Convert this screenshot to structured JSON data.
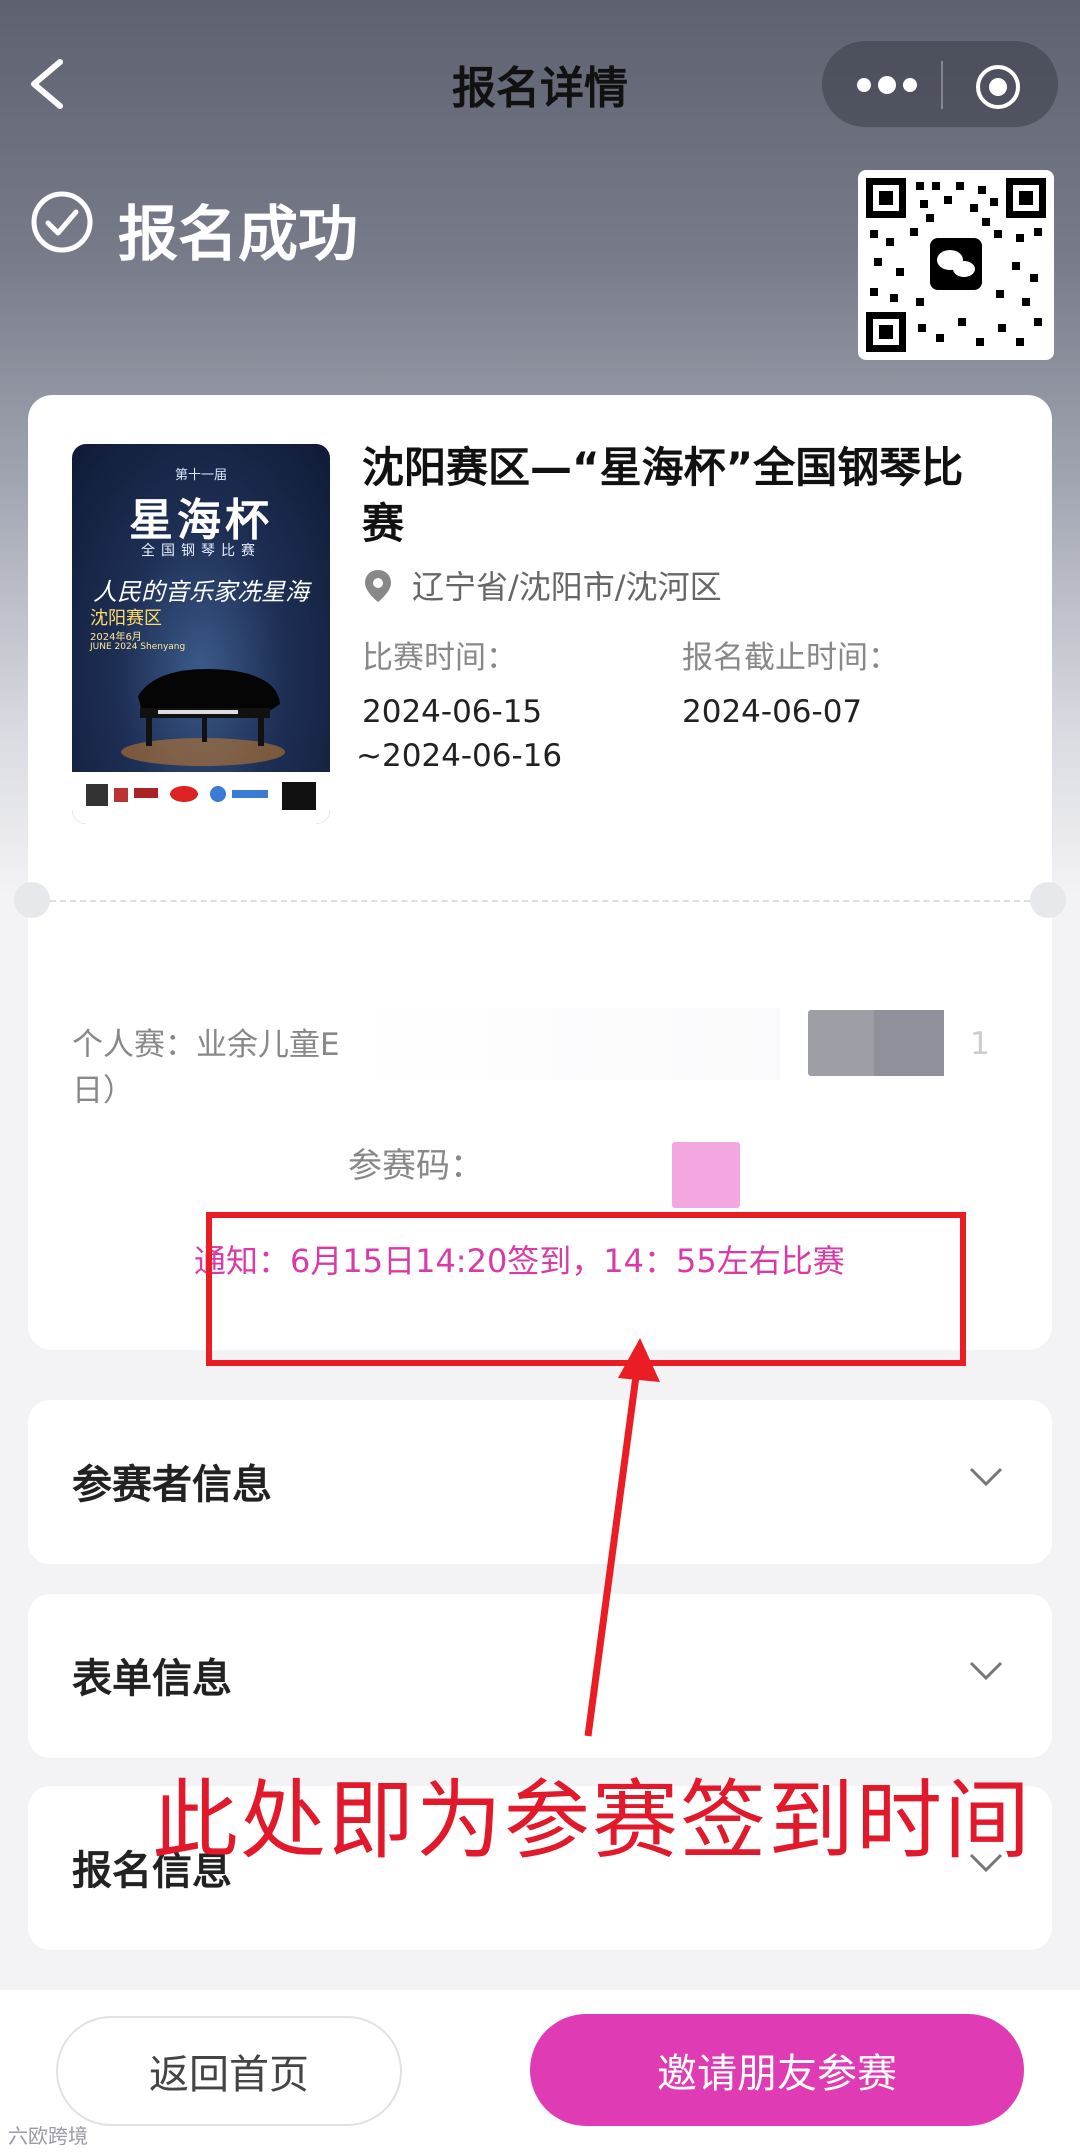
{
  "nav": {
    "title": "报名详情"
  },
  "status": {
    "text": "报名成功"
  },
  "event": {
    "poster": {
      "top_line": "第十一届",
      "title": "星海杯",
      "subtitle": "全国钢琴比赛",
      "calligraphy": "人民的音乐家冼星海",
      "region": "沈阳赛区",
      "date_cn": "2024年6月",
      "date_en": "JUNE 2024 Shenyang"
    },
    "title": "沈阳赛区—“星海杯”全国钢琴比赛",
    "location": "辽宁省/沈阳市/沈河区",
    "time_label": "比赛时间：",
    "time_start": "2024-06-15",
    "time_end": "~2024-06-16",
    "deadline_label": "报名截止时间：",
    "deadline": "2024-06-07"
  },
  "entry": {
    "category": "个人赛：业余儿童E",
    "category_tail": "日）",
    "trailing_digit": "1",
    "code_label": "参赛码：",
    "notice": "通知：6月15日14:20签到，14：55左右比赛"
  },
  "sections": [
    {
      "label": "参赛者信息"
    },
    {
      "label": "表单信息"
    },
    {
      "label": "报名信息"
    }
  ],
  "annotation": {
    "text": "此处即为参赛签到时间",
    "color": "#e2182b"
  },
  "buttons": {
    "home": "返回首页",
    "invite": "邀请朋友参赛"
  },
  "watermark": "六欧跨境",
  "colors": {
    "accent": "#df3bb4",
    "notice": "#d83aa8",
    "annotation": "#ea1c24"
  }
}
